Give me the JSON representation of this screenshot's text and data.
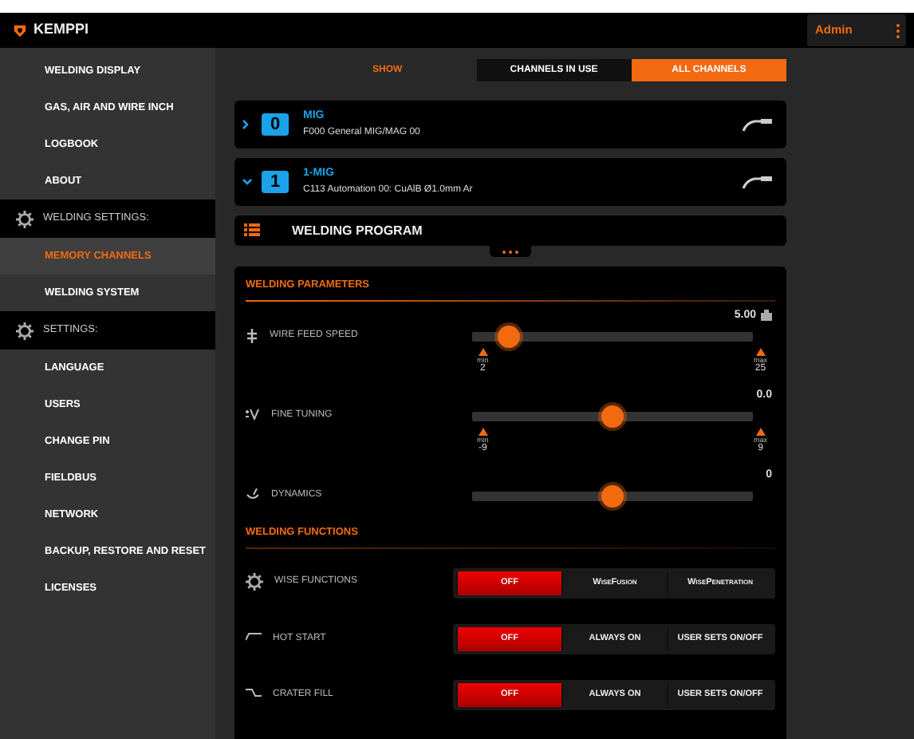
{
  "header": {
    "logo": "KEMPPI",
    "user": "Admin"
  },
  "sidebar": {
    "items": [
      {
        "kind": "item",
        "label": "WELDING DISPLAY",
        "selected": false
      },
      {
        "kind": "item",
        "label": "GAS, AIR AND WIRE INCH",
        "selected": false
      },
      {
        "kind": "item",
        "label": "LOGBOOK",
        "selected": false
      },
      {
        "kind": "item",
        "label": "ABOUT",
        "selected": false
      },
      {
        "kind": "section",
        "label": "WELDING SETTINGS:"
      },
      {
        "kind": "item",
        "label": "MEMORY CHANNELS",
        "selected": true
      },
      {
        "kind": "item",
        "label": "WELDING SYSTEM",
        "selected": false
      },
      {
        "kind": "section",
        "label": "SETTINGS:"
      },
      {
        "kind": "item",
        "label": "LANGUAGE",
        "selected": false
      },
      {
        "kind": "item",
        "label": "USERS",
        "selected": false
      },
      {
        "kind": "item",
        "label": "CHANGE PIN",
        "selected": false
      },
      {
        "kind": "item",
        "label": "FIELDBUS",
        "selected": false
      },
      {
        "kind": "item",
        "label": "NETWORK",
        "selected": false
      },
      {
        "kind": "item",
        "label": "BACKUP, RESTORE AND RESET",
        "selected": false
      },
      {
        "kind": "item",
        "label": "LICENSES",
        "selected": false
      }
    ]
  },
  "show": {
    "label": "SHOW",
    "options": [
      {
        "label": "CHANNELS IN USE",
        "selected": false
      },
      {
        "label": "ALL CHANNELS",
        "selected": true
      }
    ]
  },
  "channels": [
    {
      "number": "0",
      "name": "MIG",
      "description": "F000 General MIG/MAG 00",
      "expanded": false
    },
    {
      "number": "1",
      "name": "1-MIG",
      "description": "C113 Automation 00: CuAlB Ø1.0mm Ar",
      "expanded": true
    }
  ],
  "program": {
    "title": "WELDING PROGRAM"
  },
  "parameters": {
    "title": "WELDING PARAMETERS",
    "items": [
      {
        "label": "WIRE FEED SPEED",
        "reading": "5.00",
        "level": 0.13,
        "min_label": "min",
        "min": "2",
        "max_label": "max",
        "max": "25"
      },
      {
        "label": "FINE TUNING",
        "reading": "0.0",
        "level": 0.5,
        "min_label": "min",
        "min": "-9",
        "max_label": "max",
        "max": "9"
      },
      {
        "label": "DYNAMICS",
        "reading": "0",
        "level": 0.5
      }
    ]
  },
  "functions": {
    "title": "WELDING FUNCTIONS",
    "items": [
      {
        "label": "WISE FUNCTIONS",
        "options": [
          {
            "label": "OFF",
            "selected": true
          },
          {
            "label": "WiseFusion",
            "selected": false
          },
          {
            "label": "WisePenetration",
            "selected": false
          }
        ]
      },
      {
        "label": "HOT START",
        "options": [
          {
            "label": "OFF",
            "selected": true
          },
          {
            "label": "ALWAYS ON",
            "selected": false
          },
          {
            "label": "USER SETS ON/OFF",
            "selected": false
          }
        ]
      },
      {
        "label": "CRATER FILL",
        "options": [
          {
            "label": "OFF",
            "selected": true
          },
          {
            "label": "ALWAYS ON",
            "selected": false
          },
          {
            "label": "USER SETS ON/OFF",
            "selected": false
          }
        ]
      }
    ]
  }
}
